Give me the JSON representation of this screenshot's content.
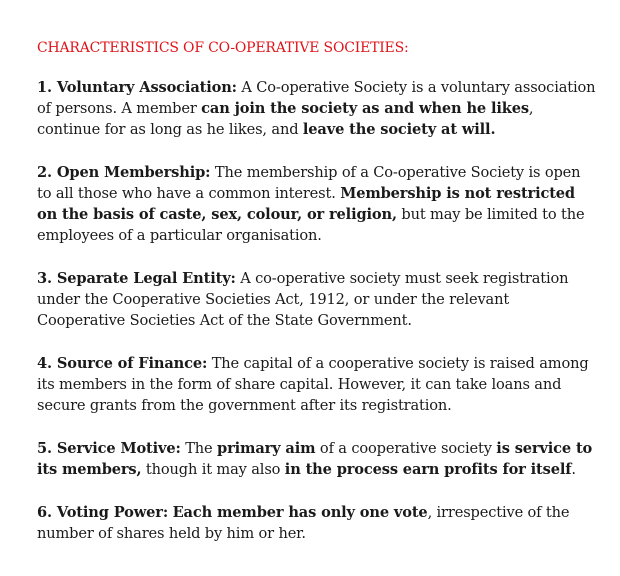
{
  "document": {
    "heading": "CHARACTERISTICS OF CO-OPERATIVE SOCIETIES:",
    "points": [
      {
        "title": "1. Voluntary Association:",
        "t1": " A Co-operative Society is a voluntary association of persons. A member ",
        "b1": "can join the society as and when he likes",
        "t2": ", continue for as long as he likes, and ",
        "b2": "leave the society at will.",
        "t3": ""
      },
      {
        "title": "2. Open Membership:",
        "t1": " The membership of a Co-operative Society is open to all those who have a common interest. ",
        "b1": "Membership is not restricted on the basis of caste, sex, colour, or religion,",
        "t2": " but may be limited to the employees of a particular organisation.",
        "b2": "",
        "t3": ""
      },
      {
        "title": "3. Separate Legal Entity:",
        "t1": " A co-operative society must seek registration under the Cooperative Societies Act, 1912, or under the relevant Cooperative Societies Act of the State Government.",
        "b1": "",
        "t2": "",
        "b2": "",
        "t3": ""
      },
      {
        "title": "4. Source of Finance:",
        "t1": " The capital of a cooperative society is raised among its members in the form of share capital. However, it can take loans and secure grants from the government after its registration.",
        "b1": "",
        "t2": "",
        "b2": "",
        "t3": ""
      },
      {
        "title": "5. Service Motive:",
        "t1": " The ",
        "b1": "primary aim",
        "t2": " of a cooperative society ",
        "b2": "is service to its members,",
        "t3": " though it may also ",
        "b3": "in the process earn profits for itself",
        "t4": "."
      },
      {
        "title": "6. Voting Power:",
        "t1": " ",
        "b1": "Each member has only one vote",
        "t2": ", irrespective of the number of shares held by him or her.",
        "b2": "",
        "t3": ""
      }
    ]
  }
}
